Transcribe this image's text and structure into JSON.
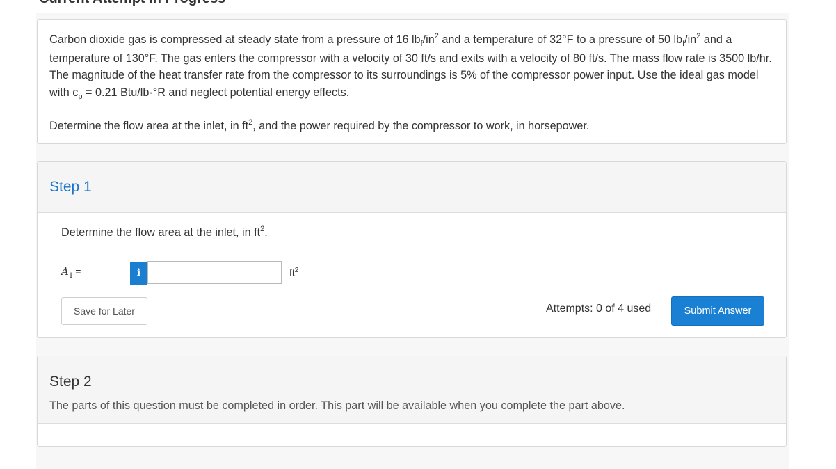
{
  "header": {
    "title": "Current Attempt in Progress"
  },
  "question": {
    "segments": {
      "s1": "Carbon dioxide gas is compressed at steady state from a pressure of 16 lb",
      "sub_f1": "f",
      "s2": "/in",
      "sup_1": "2",
      "s3": " and a temperature of 32°F to a pressure of 50 lb",
      "sub_f2": "f",
      "s4": "/in",
      "sup_2": "2",
      "s5": " and a temperature of 130°F. The gas enters the compressor with a velocity of 30 ft/s and exits with a velocity of 80 ft/s. The mass flow rate is 3500 lb/hr. The magnitude of the heat transfer rate from the compressor to its surroundings is 5% of the compressor power input. Use the ideal gas model with c",
      "sub_p": "p",
      "s6": " = 0.21 Btu/lb·°R and neglect potential energy effects."
    },
    "task": {
      "t1": "Determine the flow area at the inlet, in ft",
      "sup": "2",
      "t2": ", and the power required by the compressor to work, in horsepower."
    }
  },
  "step1": {
    "title": "Step 1",
    "prompt_text": "Determine the flow area at the inlet, in ft",
    "prompt_sup": "2",
    "prompt_end": ".",
    "answer_var": "A",
    "answer_sub": "1",
    "answer_eq": "=",
    "info_icon": "i",
    "answer_value": "",
    "unit": "ft",
    "unit_sup": "2",
    "save_label": "Save for Later",
    "attempts": "Attempts: 0 of 4 used",
    "submit_label": "Submit Answer"
  },
  "step2": {
    "title": "Step 2",
    "note": "The parts of this question must be completed in order. This part will be available when you complete the part above."
  },
  "colors": {
    "accent": "#1a80d4",
    "link": "#1a73c9"
  }
}
